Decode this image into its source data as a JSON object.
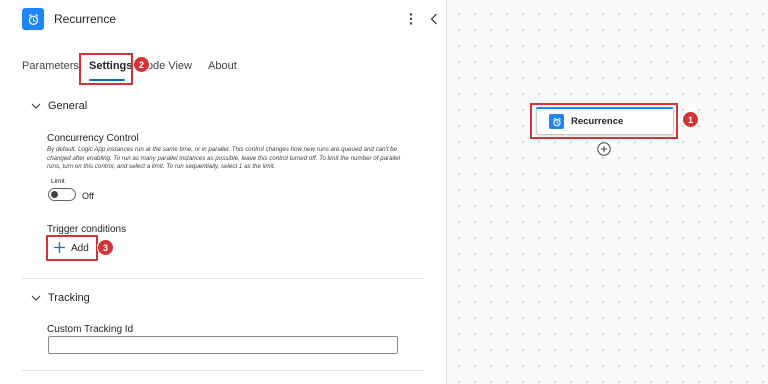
{
  "panel": {
    "title": "Recurrence",
    "tabs": [
      {
        "label": "Parameters"
      },
      {
        "label": "Settings",
        "active": true
      },
      {
        "label": "Code View"
      },
      {
        "label": "About"
      }
    ],
    "sections": {
      "general": {
        "title": "General",
        "concurrency": {
          "label": "Concurrency Control",
          "description": "By default, Logic App instances run at the same time, or in parallel. This control changes how new runs are queued and can't be changed after enabling. To run as many parallel instances as possible, leave this control turned off. To limit the number of parallel runs, turn on this control, and select a limit. To run sequentially, select 1 as the limit.",
          "limit_label": "Limit",
          "toggle_state": "Off"
        },
        "trigger_conditions": {
          "label": "Trigger conditions",
          "add_label": "Add"
        }
      },
      "tracking": {
        "title": "Tracking",
        "custom_tracking_label": "Custom Tracking Id",
        "custom_tracking_value": ""
      }
    }
  },
  "canvas": {
    "node": {
      "title": "Recurrence"
    }
  },
  "annotations": {
    "node_badge": "1",
    "settings_badge": "2",
    "add_badge": "3"
  },
  "colors": {
    "accent": "#1f85ff",
    "tab_underline": "#0f6cbd",
    "annotation_red": "#d13438"
  },
  "icons": {
    "header": "alarm-clock-icon",
    "more": "more-vertical-icon",
    "collapse": "chevron-left-icon",
    "section_toggle": "chevron-down-icon",
    "add": "plus-icon",
    "node": "alarm-clock-icon",
    "node_add": "plus-circle-icon"
  }
}
